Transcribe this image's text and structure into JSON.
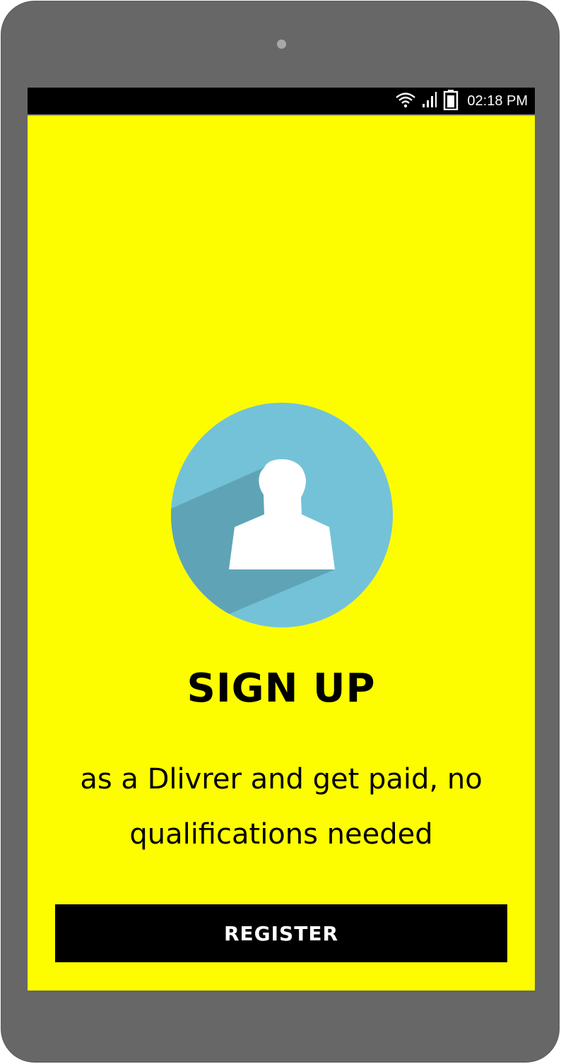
{
  "status_bar": {
    "time": "02:18 PM",
    "icons": [
      "wifi-icon",
      "signal-icon",
      "battery-icon"
    ]
  },
  "signup": {
    "avatar_icon": "user-avatar-icon",
    "title": "SIGN UP",
    "subtitle": "as a Dlivrer and get paid, no qualifications needed",
    "register_label": "REGISTER"
  },
  "colors": {
    "screen_background": "#fdfd00",
    "device_frame": "#676767",
    "avatar_circle": "#74c2d8",
    "avatar_shadow": "#5fa4b6",
    "button_background": "#000000",
    "button_text": "#ffffff"
  }
}
